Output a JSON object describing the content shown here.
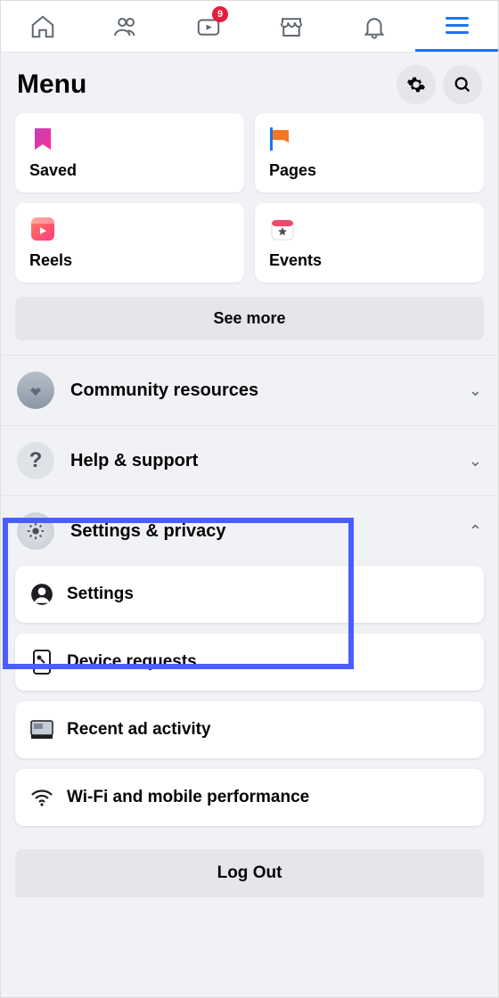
{
  "topnav": {
    "badge_count": "9"
  },
  "header": {
    "title": "Menu"
  },
  "tiles": [
    {
      "label": "Saved"
    },
    {
      "label": "Pages"
    },
    {
      "label": "Reels"
    },
    {
      "label": "Events"
    }
  ],
  "see_more_label": "See more",
  "sections": {
    "community": {
      "label": "Community resources"
    },
    "help": {
      "label": "Help & support"
    },
    "settings_privacy": {
      "label": "Settings & privacy"
    }
  },
  "settings_sub": [
    {
      "label": "Settings"
    },
    {
      "label": "Device requests"
    },
    {
      "label": "Recent ad activity"
    },
    {
      "label": "Wi-Fi and mobile performance"
    }
  ],
  "logout_label": "Log Out"
}
